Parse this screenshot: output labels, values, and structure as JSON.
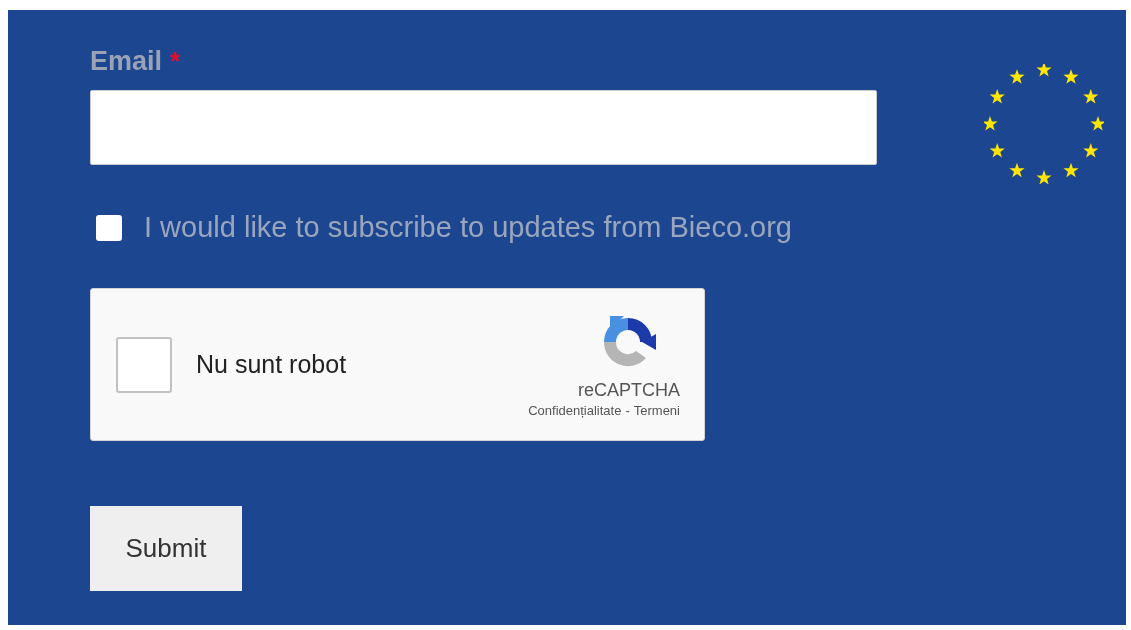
{
  "email_field": {
    "label": "Email",
    "required_mark": "*"
  },
  "subscribe": {
    "label": "I would like to subscribe to updates from Bieco.org",
    "checked": false
  },
  "captcha": {
    "label": "Nu sunt robot",
    "checked": false,
    "brand": "reCAPTCHA",
    "privacy_link": "Confidențialitate",
    "separator": "-",
    "terms_link": "Termeni"
  },
  "submit_button": {
    "label": "Submit"
  }
}
